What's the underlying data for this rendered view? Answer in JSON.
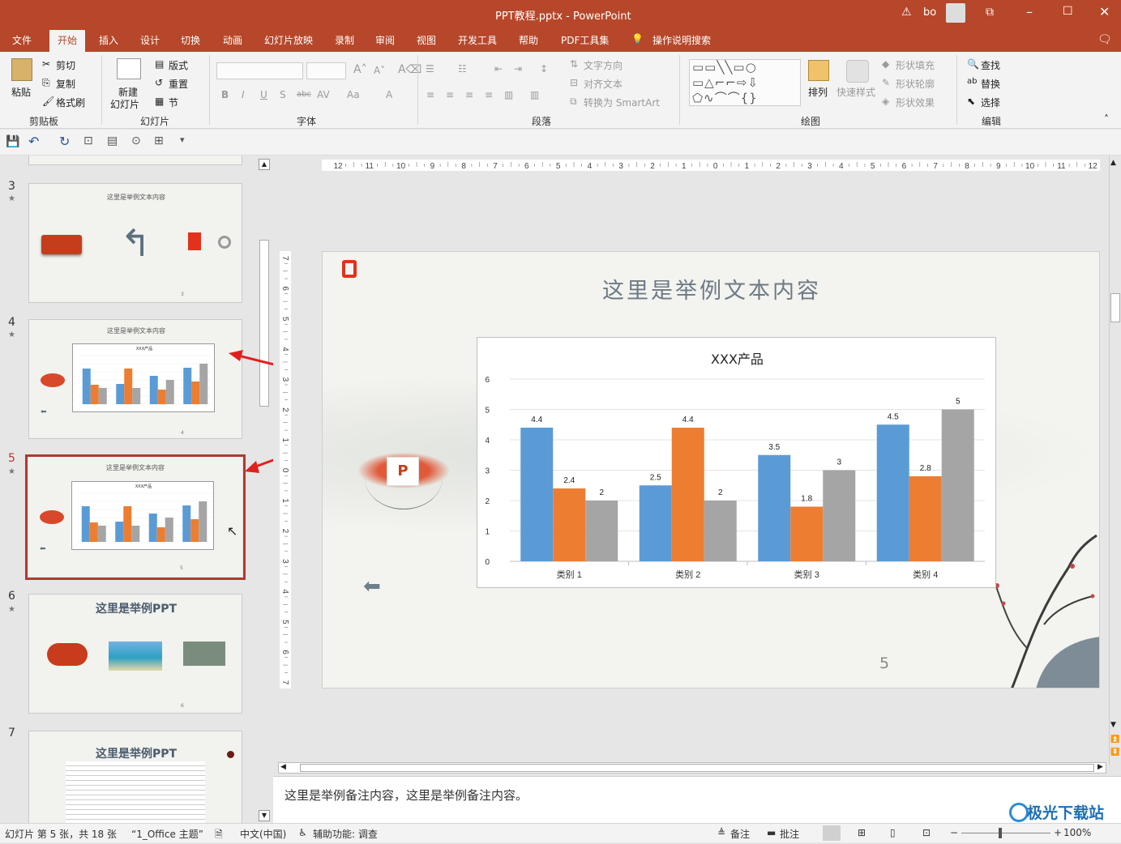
{
  "window": {
    "title": "PPT教程.pptx  -  PowerPoint",
    "user": "bo"
  },
  "menu": [
    "文件",
    "开始",
    "插入",
    "设计",
    "切换",
    "动画",
    "幻灯片放映",
    "录制",
    "审阅",
    "视图",
    "开发工具",
    "帮助",
    "PDF工具集"
  ],
  "tell_me": "操作说明搜索",
  "ribbon": {
    "clipboard": {
      "paste": "粘贴",
      "cut": "剪切",
      "copy": "复制",
      "format_painter": "格式刷",
      "group": "剪贴板"
    },
    "slides": {
      "new_slide_1": "新建",
      "new_slide_2": "幻灯片",
      "layout": "版式",
      "reset": "重置",
      "section": "节",
      "group": "幻灯片"
    },
    "font": {
      "group": "字体"
    },
    "paragraph": {
      "text_direction": "文字方向",
      "align_text": "对齐文本",
      "smartart": "转换为 SmartArt",
      "group": "段落"
    },
    "drawing": {
      "arrange": "排列",
      "quick_styles": "快速样式",
      "shape_fill": "形状填充",
      "shape_outline": "形状轮廓",
      "shape_effects": "形状效果",
      "group": "绘图"
    },
    "editing": {
      "find": "查找",
      "replace": "替换",
      "select": "选择",
      "group": "编辑"
    }
  },
  "thumbnails": [
    {
      "num": "3",
      "title": "这里是举例文本内容",
      "page": "3"
    },
    {
      "num": "4",
      "title": "这里是举例文本内容",
      "page": "4",
      "chart_title": "XXX产品"
    },
    {
      "num": "5",
      "title": "这里是举例文本内容",
      "page": "5",
      "chart_title": "XXX产品"
    },
    {
      "num": "6",
      "title": "这里是举例PPT",
      "page": "6"
    },
    {
      "num": "7",
      "title": "这里是举例PPT"
    }
  ],
  "ruler": {
    "h_ticks": [
      "12",
      "11",
      "10",
      "9",
      "8",
      "7",
      "6",
      "5",
      "4",
      "3",
      "2",
      "1",
      "0",
      "1",
      "2",
      "3",
      "4",
      "5",
      "6",
      "7",
      "8",
      "9",
      "10",
      "11",
      "12"
    ],
    "v_ticks": [
      "7",
      "6",
      "5",
      "4",
      "3",
      "2",
      "1",
      "0",
      "1",
      "2",
      "3",
      "4",
      "5",
      "6",
      "7"
    ]
  },
  "slide": {
    "title": "这里是举例文本内容",
    "page_number": "5"
  },
  "chart_data": {
    "type": "bar",
    "title": "XXX产品",
    "categories": [
      "类别 1",
      "类别 2",
      "类别 3",
      "类别 4"
    ],
    "series": [
      {
        "values": [
          4.4,
          2.5,
          3.5,
          4.5
        ],
        "color": "#5b9bd5"
      },
      {
        "values": [
          2.4,
          4.4,
          1.8,
          2.8
        ],
        "color": "#ed7d31"
      },
      {
        "values": [
          2,
          2,
          3,
          5
        ],
        "color": "#a5a5a5"
      }
    ],
    "y_ticks": [
      "0",
      "1",
      "2",
      "3",
      "4",
      "5",
      "6"
    ],
    "ylim": [
      0,
      6
    ],
    "grid": true
  },
  "notes": "这里是举例备注内容，这里是举例备注内容。",
  "status": {
    "slide_info": "幻灯片 第 5 张，共 18 张",
    "theme": "“1_Office 主题”",
    "language": "中文(中国)",
    "accessibility": "辅助功能: 调查",
    "notes_btn": "备注",
    "comments_btn": "批注",
    "zoom": "100%"
  },
  "watermark": "极光下载站"
}
